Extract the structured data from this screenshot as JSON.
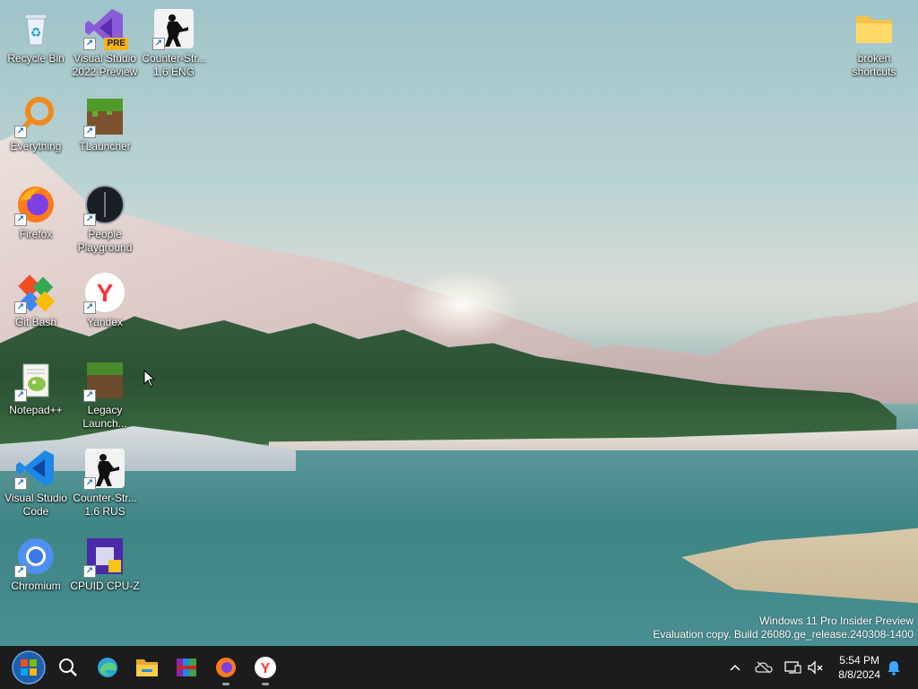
{
  "desktop_icons": [
    {
      "label": "Recycle Bin",
      "icon": "recycle-bin-icon"
    },
    {
      "label": "Visual Studio 2022 Preview",
      "icon": "visual-studio-preview-icon",
      "badge": "PRE"
    },
    {
      "label": "Counter-Str... 1.6 ENG",
      "icon": "counter-strike-icon"
    },
    {
      "label": "broken shortcuts",
      "icon": "folder-icon"
    },
    {
      "label": "Everything",
      "icon": "everything-search-icon"
    },
    {
      "label": "TLauncher",
      "icon": "minecraft-grass-block-icon"
    },
    {
      "label": "Firefox",
      "icon": "firefox-icon"
    },
    {
      "label": "People Playground",
      "icon": "people-playground-icon"
    },
    {
      "label": "Git Bash",
      "icon": "git-bash-icon"
    },
    {
      "label": "Yandex",
      "icon": "yandex-browser-icon"
    },
    {
      "label": "Notepad++",
      "icon": "notepad-plus-plus-icon"
    },
    {
      "label": "Legacy Launch...",
      "icon": "legacy-launcher-icon"
    },
    {
      "label": "Visual Studio Code",
      "icon": "vscode-icon"
    },
    {
      "label": "Counter-Str... 1.6 RUS",
      "icon": "counter-strike-icon"
    },
    {
      "label": "Chromium",
      "icon": "chromium-icon"
    },
    {
      "label": "CPUID CPU-Z",
      "icon": "cpu-z-icon"
    }
  ],
  "watermark": {
    "line1": "Windows 11 Pro Insider Preview",
    "line2": "Evaluation copy. Build 26080.ge_release.240308-1400"
  },
  "taskbar": {
    "pinned": [
      "start-button",
      "search-icon",
      "edge-icon",
      "file-explorer-icon",
      "winrar-icon",
      "firefox-icon",
      "yandex-browser-icon"
    ],
    "tray": [
      "show-hidden-icons-chevron",
      "onedrive-icon",
      "network-icon",
      "volume-muted-icon",
      "notifications-icon"
    ],
    "time": "5:54 PM",
    "date": "8/8/2024"
  },
  "colors": {
    "taskbar_bg": "#1c1c1c",
    "label_text": "#ffffff",
    "accent_blue": "#1e7fd8"
  }
}
